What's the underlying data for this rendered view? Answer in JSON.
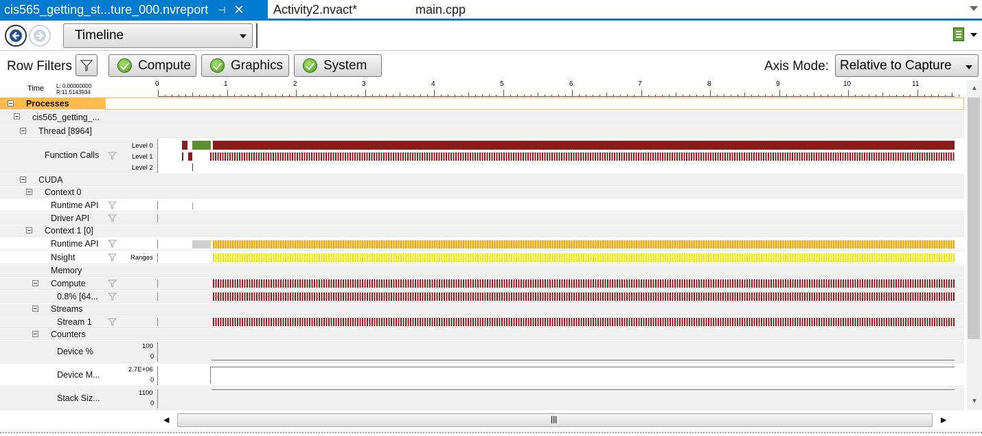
{
  "tabs": [
    {
      "label": "cis565_getting_st...ture_000.nvreport",
      "active": true,
      "pin_icon": "pin-icon",
      "close_icon": "close-icon"
    },
    {
      "label": "Activity2.nvact*",
      "active": false
    },
    {
      "label": "main.cpp",
      "active": false
    }
  ],
  "toolbar": {
    "back_icon": "back-arrow-icon",
    "forward_icon": "forward-arrow-icon",
    "view_selected": "Timeline",
    "report_icon": "report-icon"
  },
  "filter_bar": {
    "row_filters_label": "Row Filters",
    "toggles": [
      {
        "label": "Compute",
        "checked": true
      },
      {
        "label": "Graphics",
        "checked": true
      },
      {
        "label": "System",
        "checked": true
      }
    ],
    "axis_mode_label": "Axis Mode:",
    "axis_mode_value": "Relative to Capture"
  },
  "ruler": {
    "time_label": "Time",
    "left_value": "L: 0.00000000",
    "right_value": "R:11.5143934",
    "tick_labels": [
      "0",
      "1",
      "2",
      "3",
      "4",
      "5",
      "6",
      "7",
      "8",
      "9",
      "10",
      "11"
    ]
  },
  "rows": [
    {
      "label": "Processes"
    },
    {
      "label": "cis565_getting_..."
    },
    {
      "label": "Thread [8964]"
    },
    {
      "label": "Function Calls",
      "levels": [
        "Level 0",
        "Level 1",
        "Level 2"
      ]
    },
    {
      "label": "CUDA"
    },
    {
      "label": "Context 0"
    },
    {
      "label": "Runtime API"
    },
    {
      "label": "Driver API"
    },
    {
      "label": "Context 1 [0]"
    },
    {
      "label": "Runtime API"
    },
    {
      "label": "Nsight",
      "sub": "Ranges"
    },
    {
      "label": "Memory"
    },
    {
      "label": "Compute"
    },
    {
      "label": "0.8% [64..."
    },
    {
      "label": "Streams"
    },
    {
      "label": "Stream 1"
    },
    {
      "label": "Counters"
    },
    {
      "label": "Device %",
      "max": "100",
      "min": "0"
    },
    {
      "label": "Device M...",
      "max": "2.7E+06",
      "min": "0"
    },
    {
      "label": "Stack Siz...",
      "max": "1100",
      "min": "0"
    }
  ],
  "colors": {
    "accent": "#007acc",
    "selection": "#ffba50",
    "function_call": "#8b1c1c",
    "function_call_active": "#5e8f2f",
    "runtime_api": "#e3a81a",
    "nsight_range": "#e6e61a",
    "kernel": "#8b1c1c"
  }
}
